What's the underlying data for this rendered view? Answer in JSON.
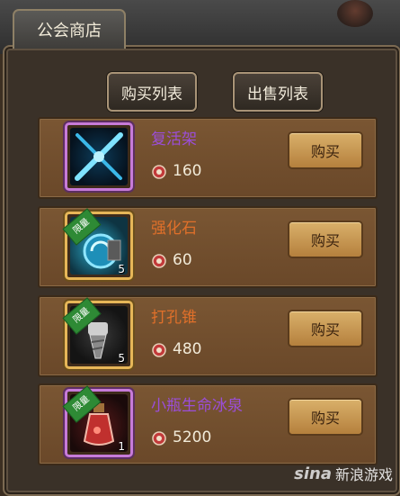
{
  "window": {
    "tab_title": "公会商店"
  },
  "toolbar": {
    "buy_list_label": "购买列表",
    "sell_list_label": "出售列表"
  },
  "items": [
    {
      "name": "复活架",
      "name_color": "#9b4ed8",
      "price": "160",
      "quantity": "",
      "rarity": "purple",
      "icon": "crossed-swords-icon",
      "buy_label": "购买"
    },
    {
      "name": "强化石",
      "name_color": "#e0702a",
      "price": "60",
      "quantity": "5",
      "rarity": "gold",
      "icon": "enhance-stone-icon",
      "buy_label": "购买"
    },
    {
      "name": "打孔锥",
      "name_color": "#e0702a",
      "price": "480",
      "quantity": "5",
      "rarity": "gold",
      "icon": "drill-icon",
      "buy_label": "购买"
    },
    {
      "name": "小瓶生命冰泉",
      "name_color": "#9b4ed8",
      "price": "5200",
      "quantity": "1",
      "rarity": "purple",
      "icon": "potion-bottle-icon",
      "buy_label": "购买"
    }
  ],
  "limited_badge": "限量",
  "watermark": {
    "logo": "sina",
    "text": "新浪游戏"
  }
}
